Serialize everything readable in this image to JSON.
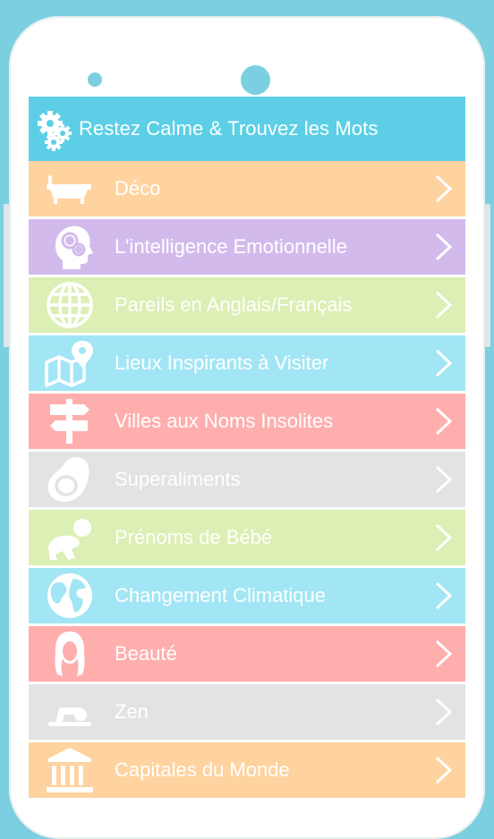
{
  "header": {
    "title": "Restez Calme & Trouvez les Mots",
    "icon": "gears-icon",
    "color": "#5ccfe6"
  },
  "menu": [
    {
      "label": "Déco",
      "icon": "bathtub-icon",
      "color": "#fed39f"
    },
    {
      "label": "L'intelligence Emotionnelle",
      "icon": "head-gears-icon",
      "color": "#d2bbec"
    },
    {
      "label": "Pareils en Anglais/Français",
      "icon": "globe-grid-icon",
      "color": "#dcefb4"
    },
    {
      "label": "Lieux Inspirants à Visiter",
      "icon": "map-pin-icon",
      "color": "#a2e6f5"
    },
    {
      "label": "Villes aux Noms Insolites",
      "icon": "signpost-icon",
      "color": "#ffaeae"
    },
    {
      "label": "Superaliments",
      "icon": "avocado-icon",
      "color": "#e3e3e3"
    },
    {
      "label": "Prénoms de Bébé",
      "icon": "baby-icon",
      "color": "#dcefb4"
    },
    {
      "label": "Changement Climatique",
      "icon": "earth-icon",
      "color": "#a2e6f5"
    },
    {
      "label": "Beauté",
      "icon": "woman-face-icon",
      "color": "#ffaeae"
    },
    {
      "label": "Zen",
      "icon": "meditation-icon",
      "color": "#e3e3e3"
    },
    {
      "label": "Capitales du Monde",
      "icon": "monument-icon",
      "color": "#fed39f"
    }
  ]
}
